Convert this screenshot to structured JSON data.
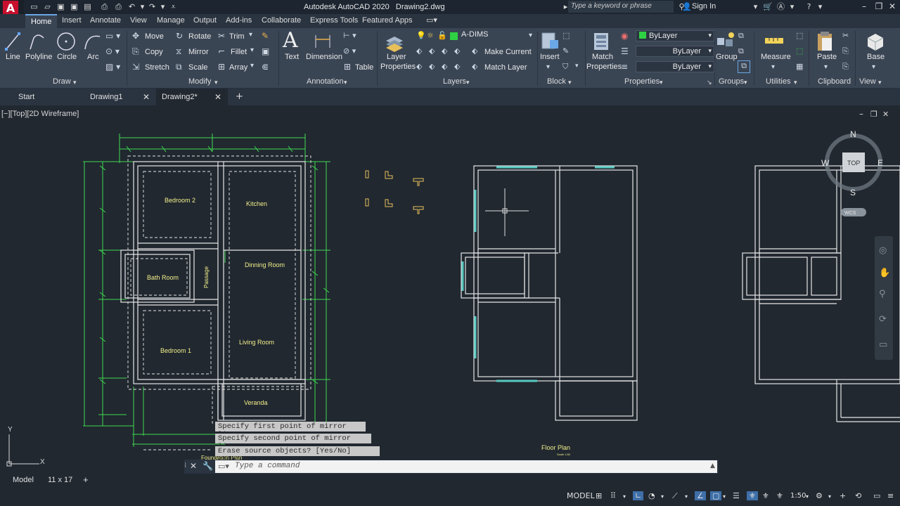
{
  "app": {
    "title": "Autodesk AutoCAD 2020",
    "document": "Drawing2.dwg",
    "logo_letter": "A",
    "search_placeholder": "Type a keyword or phrase",
    "sign_in": "Sign In"
  },
  "ribbon_tabs": [
    "Home",
    "Insert",
    "Annotate",
    "View",
    "Manage",
    "Output",
    "Add-ins",
    "Collaborate",
    "Express Tools",
    "Featured Apps"
  ],
  "ribbon": {
    "draw": {
      "label": "Draw",
      "line": "Line",
      "polyline": "Polyline",
      "circle": "Circle",
      "arc": "Arc"
    },
    "modify": {
      "label": "Modify",
      "move": "Move",
      "rotate": "Rotate",
      "trim": "Trim",
      "copy": "Copy",
      "mirror": "Mirror",
      "fillet": "Fillet",
      "stretch": "Stretch",
      "scale": "Scale",
      "array": "Array"
    },
    "annotation": {
      "label": "Annotation",
      "text": "Text",
      "dimension": "Dimension",
      "table": "Table"
    },
    "layers": {
      "label": "Layers",
      "layer_properties_1": "Layer",
      "layer_properties_2": "Properties",
      "current_layer": "A-DIMS",
      "make_current": "Make Current",
      "match_layer": "Match Layer"
    },
    "block": {
      "label": "Block",
      "insert": "Insert"
    },
    "properties": {
      "label": "Properties",
      "match_properties_1": "Match",
      "match_properties_2": "Properties",
      "color": "ByLayer",
      "linetype": "ByLayer",
      "lineweight": "ByLayer"
    },
    "groups": {
      "label": "Groups",
      "group": "Group"
    },
    "utilities": {
      "label": "Utilities",
      "measure": "Measure"
    },
    "clipboard": {
      "label": "Clipboard",
      "paste": "Paste"
    },
    "view": {
      "label": "View",
      "base": "Base"
    }
  },
  "file_tabs": [
    {
      "label": "Start"
    },
    {
      "label": "Drawing1"
    },
    {
      "label": "Drawing2*"
    }
  ],
  "viewport": {
    "label": "[−][Top][2D Wireframe]",
    "viewcube": {
      "n": "N",
      "s": "S",
      "e": "E",
      "w": "W",
      "top": "TOP",
      "wcs": "WCS"
    }
  },
  "drawing": {
    "rooms": [
      "Bedroom 2",
      "Kitchen",
      "Dinning Room",
      "Bath Room",
      "Passage",
      "Bedroom 1",
      "Living Room",
      "Veranda"
    ],
    "foundation_title": "Foundation Plan",
    "floor_title": "Floor Plan",
    "floor_scale": "Scale 1:50"
  },
  "command": {
    "history": [
      "Specify first point of mirror line:",
      "Specify second point of mirror line:",
      "Erase source objects? [Yes/No] <No>: N"
    ],
    "placeholder": "Type a command"
  },
  "layout_tabs": [
    "Model",
    "11 x 17"
  ],
  "status": {
    "model": "MODEL",
    "scale": "1:50"
  }
}
